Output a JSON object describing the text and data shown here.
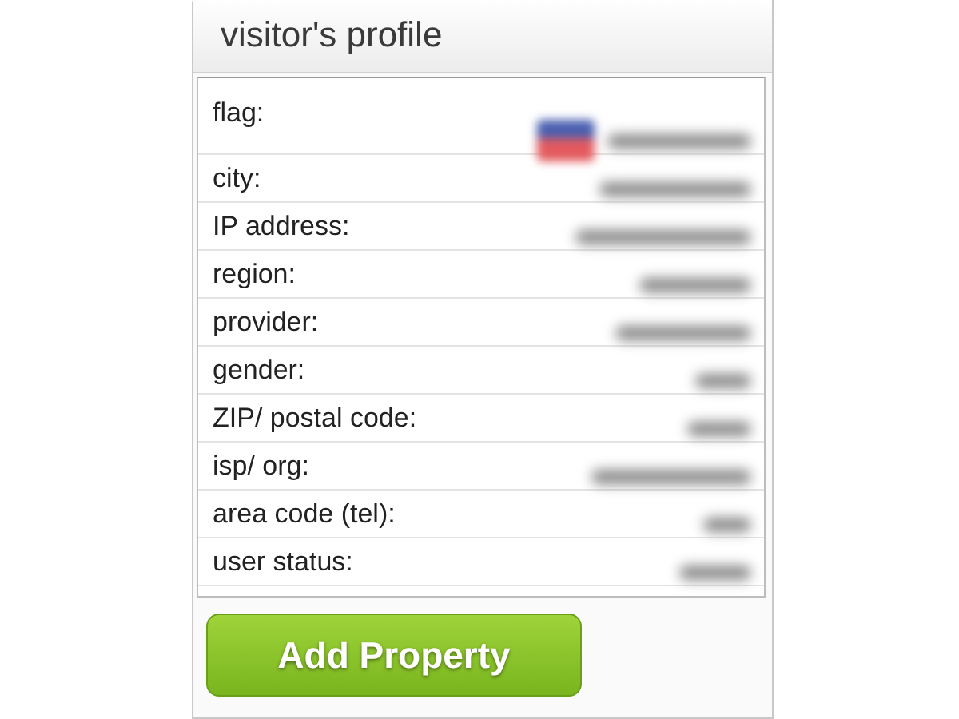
{
  "panel": {
    "title": "visitor's profile"
  },
  "rows": [
    {
      "label": "flag:",
      "kind": "flag"
    },
    {
      "label": "city:",
      "kind": "text"
    },
    {
      "label": "IP address:",
      "kind": "text"
    },
    {
      "label": "region:",
      "kind": "text"
    },
    {
      "label": "provider:",
      "kind": "text"
    },
    {
      "label": "gender:",
      "kind": "text"
    },
    {
      "label": "ZIP/ postal code:",
      "kind": "text"
    },
    {
      "label": "isp/ org:",
      "kind": "text"
    },
    {
      "label": "area code (tel):",
      "kind": "text"
    },
    {
      "label": "user status:",
      "kind": "text"
    }
  ],
  "button": {
    "label": "Add Property"
  }
}
